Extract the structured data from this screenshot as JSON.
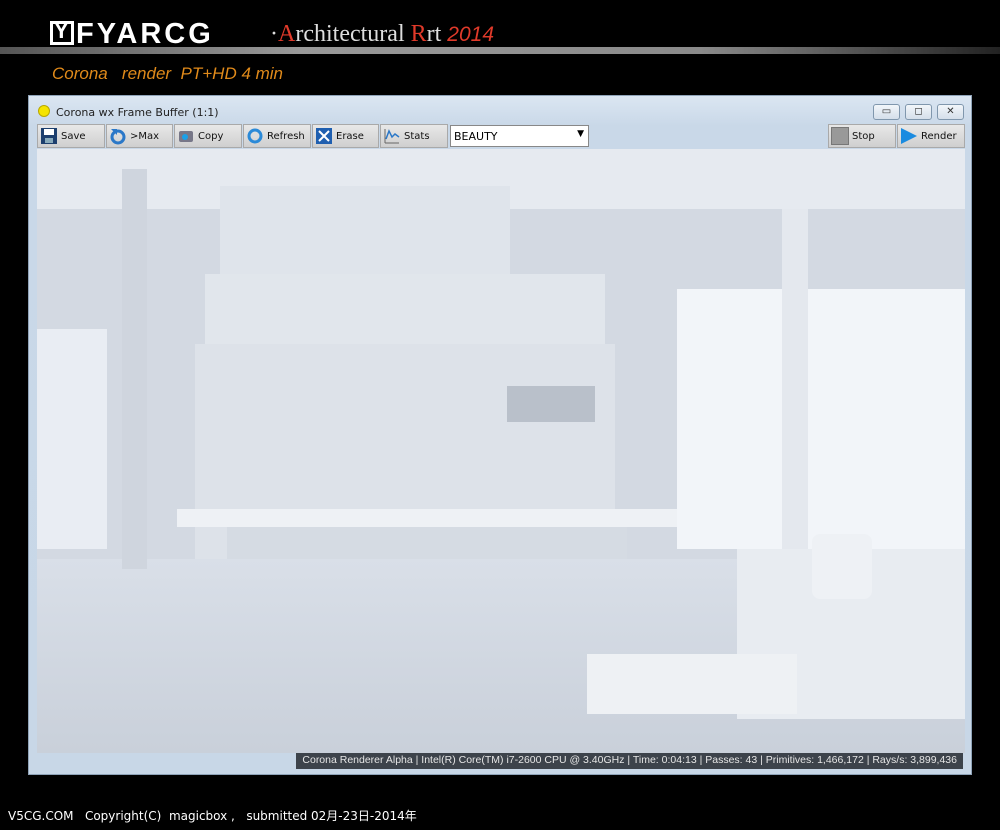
{
  "banner": {
    "logo": "FYARCG",
    "separator": "·",
    "title_a": "A",
    "title_rest1": "rchitectural ",
    "title_r": "R",
    "title_rest2": "rt ",
    "year": "2014",
    "subtitle": "Corona   render  PT+HD 4 min"
  },
  "window": {
    "title": "Corona wx Frame Buffer (1:1)",
    "controls": {
      "minimize": "▭",
      "maximize": "◻",
      "close": "✕"
    }
  },
  "toolbar": {
    "save": "Save",
    "max": ">Max",
    "copy": "Copy",
    "refresh": "Refresh",
    "erase": "Erase",
    "stats": "Stats",
    "channel": "BEAUTY",
    "stop": "Stop",
    "render": "Render"
  },
  "colors": {
    "accent_red": "#e03a2a",
    "subtitle_orange": "#e08a1a",
    "render_play": "#1a8be0"
  },
  "status": "Corona Renderer Alpha | Intel(R) Core(TM) i7-2600 CPU @ 3.40GHz | Time: 0:04:13 | Passes: 43 | Primitives: 1,466,172 | Rays/s: 3,899,436",
  "footer": "V5CG.COM   Copyright(C)  magicbox ,   submitted 02月-23日-2014年"
}
